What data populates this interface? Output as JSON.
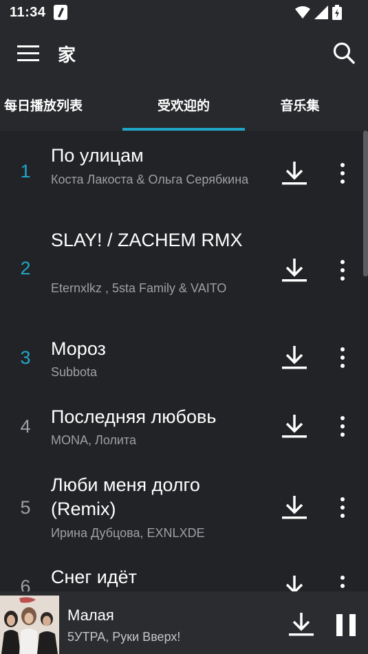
{
  "status": {
    "time": "11:34"
  },
  "app": {
    "title": "家"
  },
  "tabs": [
    {
      "label": "每日播放列表",
      "active": false
    },
    {
      "label": "受欢迎的",
      "active": true
    },
    {
      "label": "音乐集",
      "active": false
    }
  ],
  "colors": {
    "accent": "#1fa7c9",
    "background": "#222326",
    "bar": "#28292d",
    "muted": "#9ea0a5"
  },
  "songs": [
    {
      "rank": "1",
      "title": "По улицам",
      "artist": "Коста Лакоста   &  Ольга Серябкина",
      "highlight": true
    },
    {
      "rank": "2",
      "title": "SLAY! / ZACHEM RMX",
      "artist": "Eternxlkz ,  5sta Family   &  VAITO",
      "highlight": true
    },
    {
      "rank": "3",
      "title": "Мороз",
      "artist": "Subbota",
      "highlight": true
    },
    {
      "rank": "4",
      "title": "Последняя любовь",
      "artist": "MONA, Лолита",
      "highlight": false
    },
    {
      "rank": "5",
      "title": "Люби меня долго (Remix)",
      "artist": "Ирина Дубцова, EXNLXDE",
      "highlight": false
    },
    {
      "rank": "6",
      "title": "Снег идёт",
      "artist": "",
      "highlight": false
    }
  ],
  "now_playing": {
    "title": "Малая",
    "artist": "5УТРА, Руки Вверх!"
  },
  "icons": {
    "menu": "menu-icon",
    "search": "search-icon",
    "download": "download-icon",
    "more": "more-vertical-icon",
    "pause": "pause-icon",
    "wifi": "wifi-icon",
    "signal": "signal-icon",
    "battery": "battery-icon"
  }
}
